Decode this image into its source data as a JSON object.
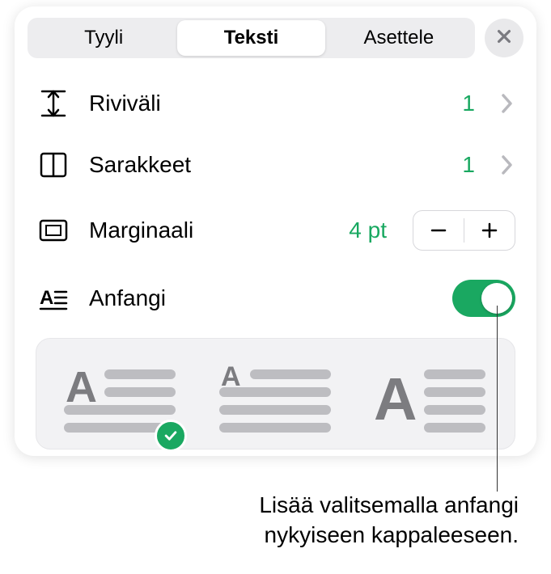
{
  "header": {
    "tabs": [
      {
        "label": "Tyyli",
        "active": false
      },
      {
        "label": "Teksti",
        "active": true
      },
      {
        "label": "Asettele",
        "active": false
      }
    ]
  },
  "rows": {
    "lineSpacing": {
      "label": "Riviväli",
      "value": "1"
    },
    "columns": {
      "label": "Sarakkeet",
      "value": "1"
    },
    "margin": {
      "label": "Marginaali",
      "value": "4 pt"
    },
    "dropcap": {
      "label": "Anfangi",
      "enabled": true
    }
  },
  "caption": {
    "line1": "Lisää valitsemalla anfangi",
    "line2": "nykyiseen kappaleeseen."
  }
}
